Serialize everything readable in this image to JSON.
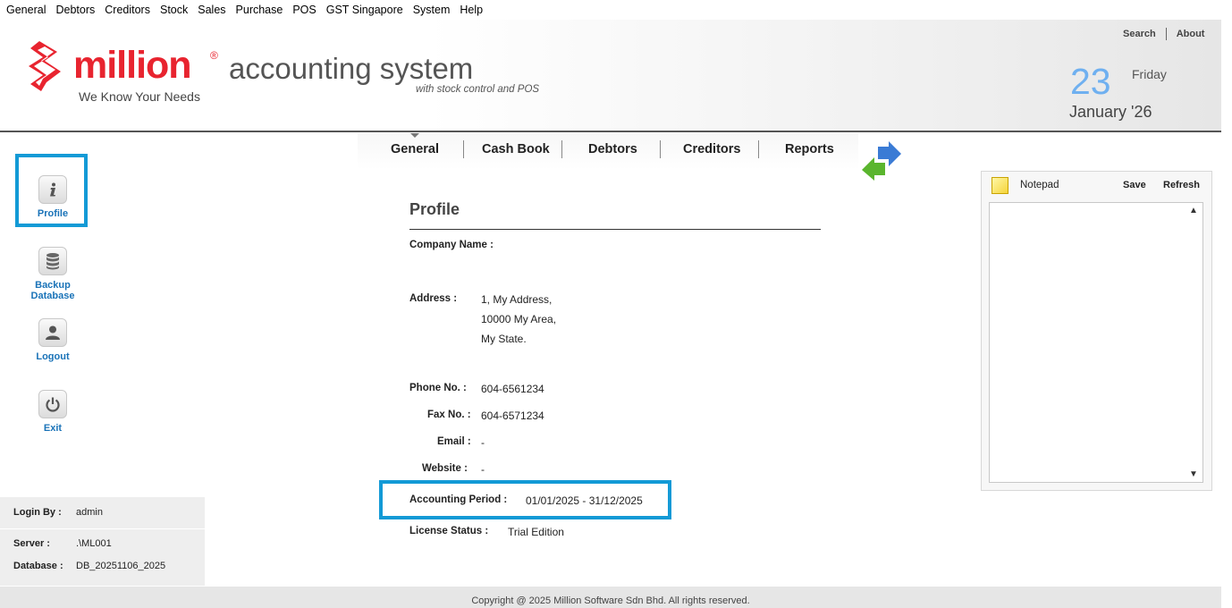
{
  "menu": [
    "General",
    "Debtors",
    "Creditors",
    "Stock",
    "Sales",
    "Purchase",
    "POS",
    "GST Singapore",
    "System",
    "Help"
  ],
  "header": {
    "brand": "million",
    "registered": "®",
    "tagline": "We Know Your Needs",
    "product": "accounting system",
    "product_sub": "with stock control and POS",
    "search": "Search",
    "about": "About",
    "date_day": "23",
    "date_weekday": "Friday",
    "date_month": "January '26"
  },
  "tabs": [
    "General",
    "Cash Book",
    "Debtors",
    "Creditors",
    "Reports"
  ],
  "sidebar": [
    {
      "label": "Profile",
      "icon": "info-icon"
    },
    {
      "label": "Backup Database",
      "icon": "database-icon"
    },
    {
      "label": "Logout",
      "icon": "user-icon"
    },
    {
      "label": "Exit",
      "icon": "power-icon"
    }
  ],
  "login": {
    "login_by_label": "Login By :",
    "login_by": "admin",
    "server_label": "Server :",
    "server": ".\\ML001",
    "database_label": "Database :",
    "database": "DB_20251106_2025"
  },
  "profile": {
    "title": "Profile",
    "company_label": "Company Name :",
    "company": "",
    "address_label": "Address :",
    "address1": "1, My Address,",
    "address2": "10000 My Area,",
    "address3": "My State.",
    "phone_label": "Phone  No. :",
    "phone": "604-6561234",
    "fax_label": "Fax No. :",
    "fax": "604-6571234",
    "email_label": "Email :",
    "email": "-",
    "website_label": "Website :",
    "website": "-",
    "period_label": "Accounting Period :",
    "period": "01/01/2025 - 31/12/2025",
    "license_label": "License Status :",
    "license": "Trial Edition"
  },
  "notepad": {
    "title": "Notepad",
    "save": "Save",
    "refresh": "Refresh",
    "content": ""
  },
  "footer": "Copyright @ 2025 Million Software Sdn Bhd. All rights reserved.",
  "colors": {
    "brand_red": "#e8242f",
    "link_blue": "#1a73b8",
    "highlight": "#139ad6",
    "date_blue": "#6fb0f0"
  }
}
